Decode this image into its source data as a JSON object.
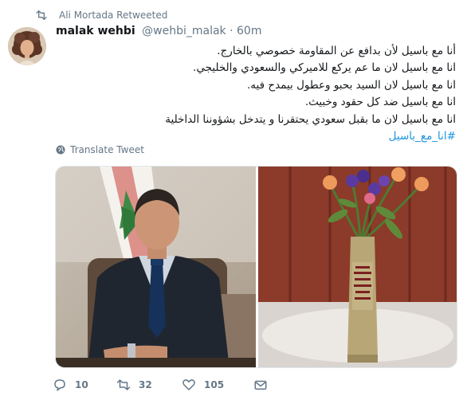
{
  "retweet_banner": {
    "text": "Ali Mortada Retweeted"
  },
  "tweet": {
    "display_name": "malak wehbi",
    "handle": "@wehbi_malak",
    "separator": "·",
    "time": "60m",
    "lines": [
      "أنا مع باسيل لأن بدافع عن المقاومة خصوصي بالخارج.",
      "انا مع باسيل لان ما عم يركع للاميركي والسعودي والخليجي.",
      "انا مع باسيل لان السيد بحبو وعطول بيمدح فيه.",
      "انا مع باسيل ضد كل حقود وخبيث.",
      "انا مع باسيل لان ما بقبل سعودي يحتقرنا و يتدخل بشؤوننا الداخلية"
    ],
    "hashtag": "#انا_مع_باسيل",
    "translate_label": "Translate Tweet",
    "media": {
      "left_photo": "portrait-man-in-suit-lebanese-flag",
      "right_photo": "flowers-in-artillery-shell-vase"
    }
  },
  "actions": {
    "reply_count": "10",
    "retweet_count": "32",
    "like_count": "105"
  },
  "colors": {
    "link": "#1b95e0",
    "muted": "#657786",
    "text": "#14171a"
  }
}
